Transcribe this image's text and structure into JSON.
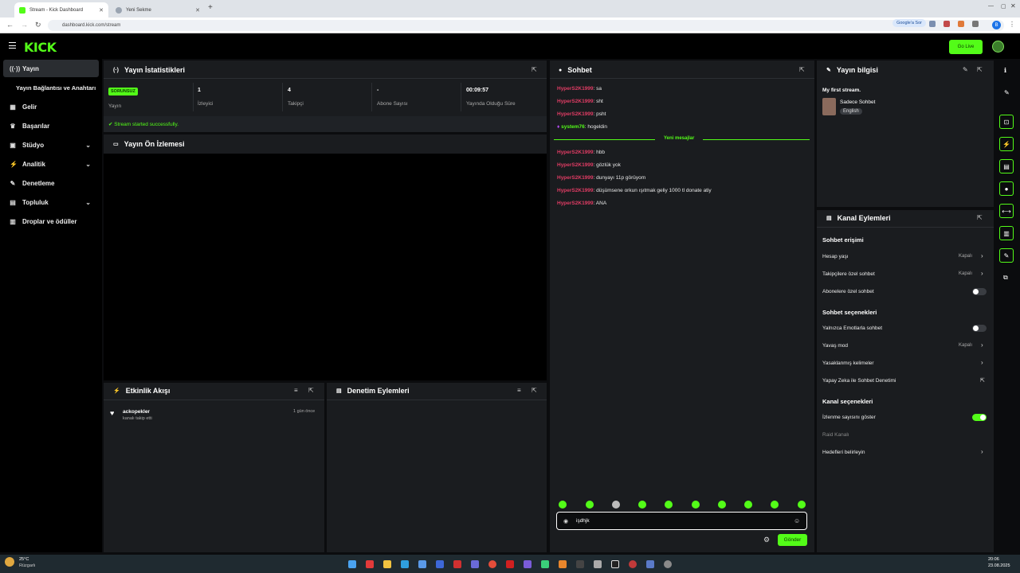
{
  "browser": {
    "tabs": [
      {
        "title": "Stream - Kick Dashboard"
      },
      {
        "title": "Yeni Sekme"
      }
    ],
    "url": "dashboard.kick.com/stream",
    "omnibox_chip": "Google'a Sor",
    "profile_initial": "B"
  },
  "header": {
    "logo": "KICK",
    "go_live_label": "Go Live"
  },
  "sidebar": {
    "items": [
      {
        "label": "Yayın",
        "icon": "broadcast-icon"
      },
      {
        "label": "Yayın Bağlantısı ve Anahtarı",
        "icon": ""
      },
      {
        "label": "Gelir",
        "icon": "revenue-icon"
      },
      {
        "label": "Başarılar",
        "icon": "trophy-icon"
      },
      {
        "label": "Stüdyo",
        "icon": "studio-icon"
      },
      {
        "label": "Analitik",
        "icon": "analytics-icon"
      },
      {
        "label": "Denetleme",
        "icon": "wrench-icon"
      },
      {
        "label": "Topluluk",
        "icon": "community-icon"
      },
      {
        "label": "Droplar ve ödüller",
        "icon": "drops-icon"
      }
    ]
  },
  "stats": {
    "title": "Yayın İstatistikleri",
    "status_badge": "SORUNSUZ",
    "items": [
      {
        "value": "",
        "label": "Yayın"
      },
      {
        "value": "1",
        "label": "İzleyici"
      },
      {
        "value": "4",
        "label": "Takipçi"
      },
      {
        "value": "-",
        "label": "Abone Sayısı"
      },
      {
        "value": "00:09:57",
        "label": "Yayında Olduğu Süre"
      }
    ],
    "success_msg": "Stream started successfully."
  },
  "preview": {
    "title": "Yayın Ön İzlemesi"
  },
  "activity": {
    "title": "Etkinlik Akışı",
    "items": [
      {
        "user": "ackopekler",
        "desc": "kanalı takip etti",
        "time": "1 gün önce"
      }
    ]
  },
  "moderation": {
    "title": "Denetim Eylemleri"
  },
  "chat": {
    "title": "Sohbet",
    "messages_before": [
      {
        "user": "HyperS2K1999",
        "text": "sa"
      },
      {
        "user": "HyperS2K1999",
        "text": "sht"
      },
      {
        "user": "HyperS2K1999",
        "text": "psht"
      },
      {
        "user": "system76",
        "text": "hogeldin"
      }
    ],
    "new_messages_divider": "Yeni mesajlar",
    "messages_after": [
      {
        "user": "HyperS2K1999",
        "text": "hbb"
      },
      {
        "user": "HyperS2K1999",
        "text": "gözlük yok"
      },
      {
        "user": "HyperS2K1999",
        "text": "dunyayı 11p görüyom"
      },
      {
        "user": "HyperS2K1999",
        "text": "düşümsene orkun ışıtmak geliy 1000 tl donate atiy"
      },
      {
        "user": "HyperS2K1999",
        "text": "ANA"
      }
    ],
    "input_value": "işdhjk",
    "send_label": "Gönder"
  },
  "stream_info": {
    "title": "Yayın bilgisi",
    "stream_title": "My first stream.",
    "category": "Sadece Sohbet",
    "language": "English"
  },
  "channel_actions": {
    "title": "Kanal Eylemleri",
    "sections": {
      "chat_access": "Sohbet erişimi",
      "chat_options": "Sohbet seçenekleri",
      "channel_options": "Kanal seçenekleri"
    },
    "rows": {
      "account_age": {
        "label": "Hesap yaşı",
        "value": "Kapalı"
      },
      "followers_only": {
        "label": "Takipçilere özel sohbet",
        "value": "Kapalı"
      },
      "subs_only": {
        "label": "Abonelere özel sohbet"
      },
      "emotes_only": {
        "label": "Yalnızca Emotlarla sohbet"
      },
      "slow_mode": {
        "label": "Yavaş mod",
        "value": "Kapalı"
      },
      "banned_words": {
        "label": "Yasaklanmış kelimeler"
      },
      "ai_moderation": {
        "label": "Yapay Zeka ile Sohbet Denetimi"
      },
      "show_viewers": {
        "label": "İzlenme sayısını göster"
      },
      "raid": {
        "label": "Raid Kanalı"
      },
      "goals": {
        "label": "Hedefleri belirleyin"
      }
    },
    "toggles": {
      "subs_only": false,
      "emotes_only": false,
      "show_viewers": true
    }
  },
  "taskbar": {
    "weather_temp": "25°C",
    "weather_desc": "Rüzgarlı",
    "time": "20:06",
    "date": "23.08.2025"
  },
  "colors": {
    "accent": "#53fc18",
    "chat_user": "#e03c64",
    "panel": "#1a1c1f",
    "background": "#0b0c0e"
  }
}
